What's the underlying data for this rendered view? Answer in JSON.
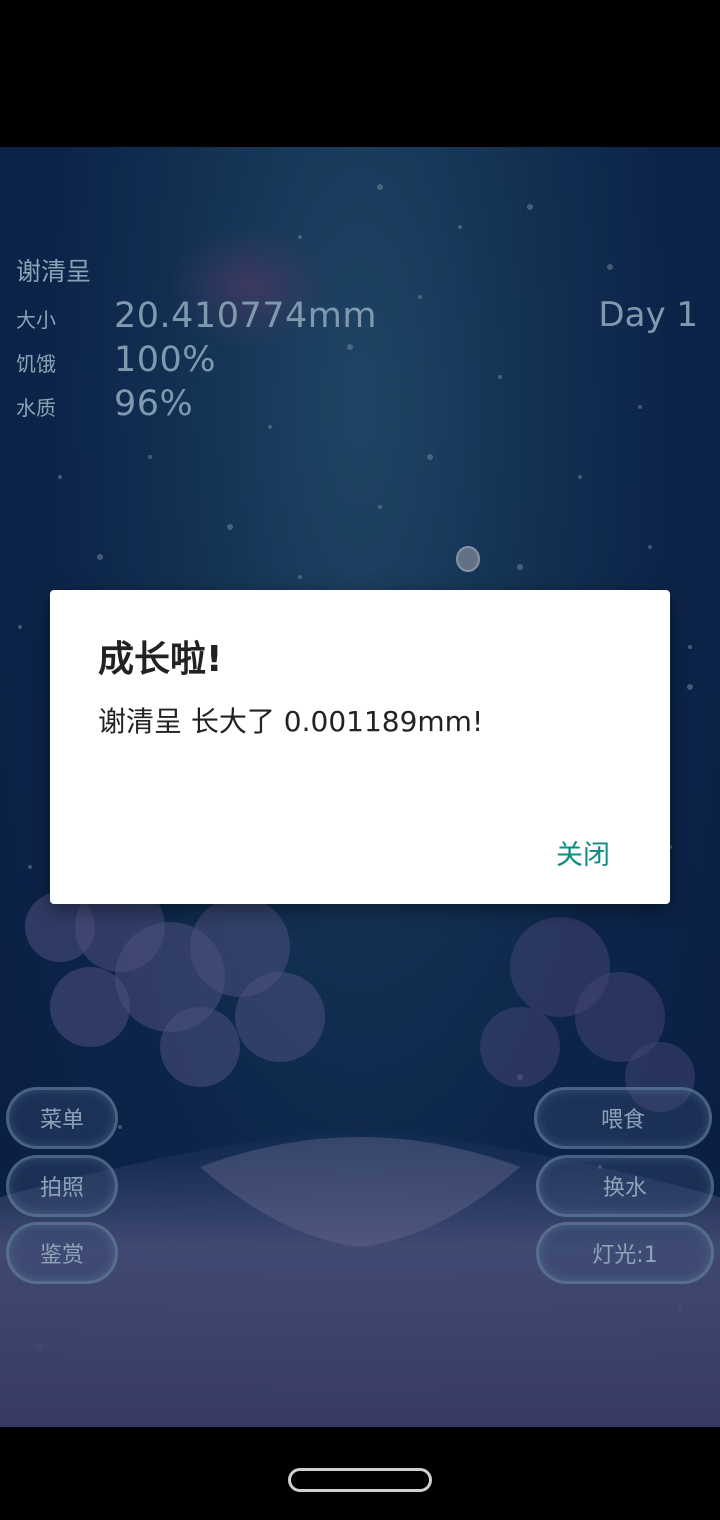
{
  "fish": {
    "name": "谢清呈",
    "size_label": "大小",
    "size_value": "20.410774mm",
    "hunger_label": "饥饿",
    "hunger_value": "100%",
    "water_label": "水质",
    "water_value": "96%",
    "day": "Day 1"
  },
  "buttons": {
    "menu": "菜单",
    "photo": "拍照",
    "gallery": "鉴赏",
    "feed": "喂食",
    "change_water": "换水",
    "light": "灯光:1"
  },
  "dialog": {
    "title": "成长啦!",
    "message": "谢清呈 长大了 0.001189mm!",
    "close": "关闭"
  },
  "colors": {
    "dialog_accent": "#0e8c7f",
    "water_dark": "#0a2148",
    "water_light": "#2a5a7c"
  }
}
